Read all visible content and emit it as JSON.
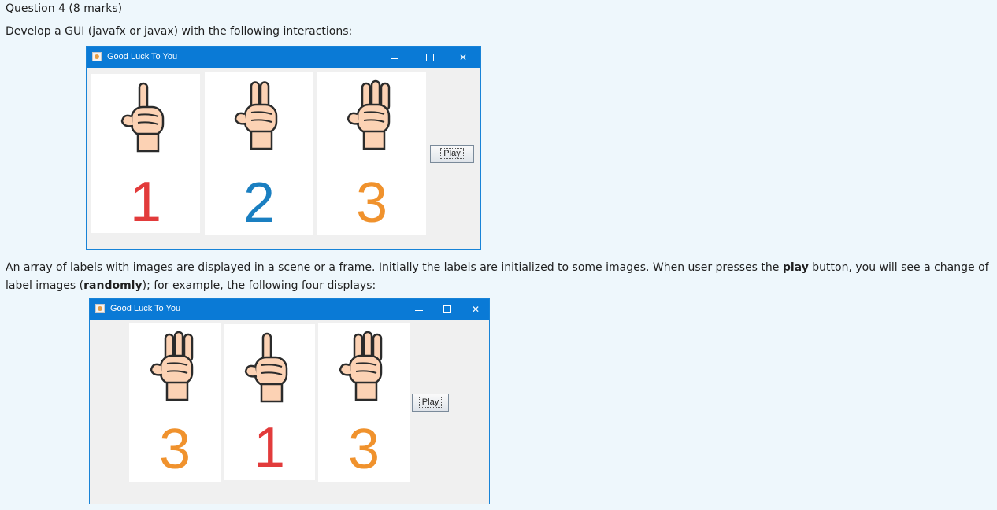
{
  "question": {
    "title": "Question 4 (8 marks)",
    "line1": "Develop a GUI (javafx or javax) with the following interactions:",
    "para_start": "An array of labels with images are displayed in a scene or a frame. Initially the labels are initialized to some images. When user presses the ",
    "para_play": "play",
    "para_mid": " button, you will see a change of label images (",
    "para_randomly": "randomly",
    "para_end": "); for example, the following four  displays:"
  },
  "windows": [
    {
      "title": "Good Luck To You",
      "button_label": "Play",
      "cards": [
        {
          "value": "1",
          "color": "#e23b3b",
          "fingers": 1
        },
        {
          "value": "2",
          "color": "#1a7fc1",
          "fingers": 2
        },
        {
          "value": "3",
          "color": "#f0922d",
          "fingers": 3
        }
      ]
    },
    {
      "title": "Good Luck To You",
      "button_label": "Play",
      "cards": [
        {
          "value": "3",
          "color": "#f0922d",
          "fingers": 3
        },
        {
          "value": "1",
          "color": "#e23b3b",
          "fingers": 1
        },
        {
          "value": "3",
          "color": "#f0922d",
          "fingers": 3
        }
      ]
    }
  ],
  "colors": {
    "titlebar": "#0a7ad6",
    "skin": "#fcd2b4",
    "outline": "#2b2b2b",
    "page_bg": "#eef7fc"
  }
}
